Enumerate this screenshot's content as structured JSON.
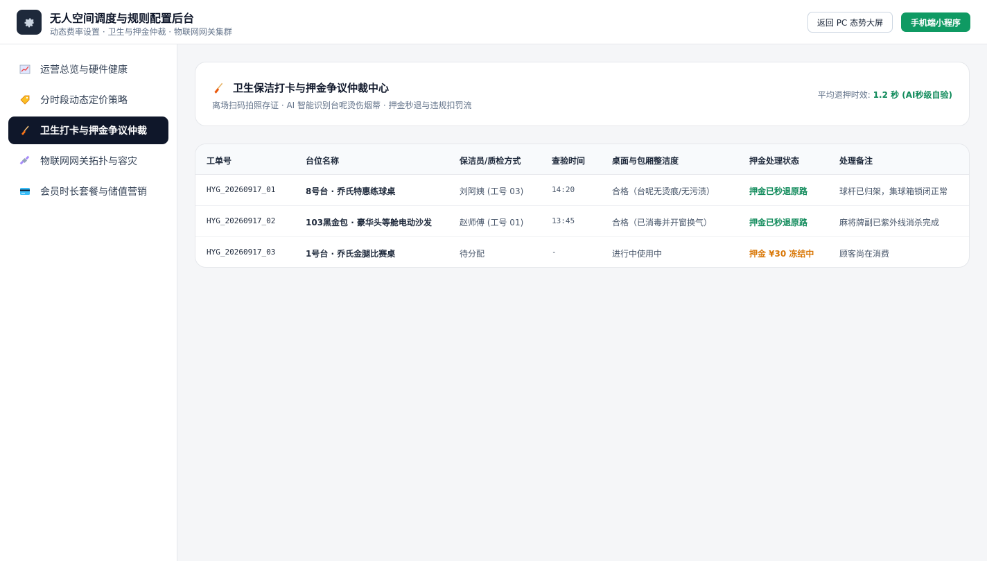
{
  "header": {
    "title": "无人空间调度与规则配置后台",
    "subtitle": "动态费率设置 · 卫生与押金仲裁 · 物联网网关集群",
    "back_button": "返回 PC 态势大屏",
    "mini_program_button": "手机端小程序",
    "logo_icon": "gear-icon"
  },
  "sidebar": {
    "items": [
      {
        "label": "运营总览与硬件健康",
        "icon": "chart-line-icon",
        "active": false
      },
      {
        "label": "分时段动态定价策略",
        "icon": "price-tag-icon",
        "active": false
      },
      {
        "label": "卫生打卡与押金争议仲裁",
        "icon": "broom-icon",
        "active": true
      },
      {
        "label": "物联网网关拓扑与容灾",
        "icon": "satellite-icon",
        "active": false
      },
      {
        "label": "会员时长套餐与储值营销",
        "icon": "credit-card-icon",
        "active": false
      }
    ]
  },
  "hero": {
    "title": "卫生保洁打卡与押金争议仲裁中心",
    "subtitle": "离场扫码拍照存证 · AI 智能识别台呢烫伤烟蒂 · 押金秒退与违规扣罚流",
    "stat_label": "平均退押时效: ",
    "stat_value": "1.2 秒 (AI秒级自验)"
  },
  "table": {
    "headers": [
      "工单号",
      "台位名称",
      "保洁员/质检方式",
      "查验时间",
      "桌面与包厢整洁度",
      "押金处理状态",
      "处理备注"
    ],
    "rows": [
      {
        "id": "HYG_20260917_01",
        "table": "8号台 · 乔氏特惠练球桌",
        "cleaner": "刘阿姨 (工号 03)",
        "time": "14:20",
        "cleanliness": "合格（台呢无烫痕/无污渍）",
        "status": "押金已秒退原路",
        "status_type": "green",
        "note": "球杆已归架，集球箱锁闭正常"
      },
      {
        "id": "HYG_20260917_02",
        "table": "103黑金包 · 豪华头等舱电动沙发",
        "cleaner": "赵师傅 (工号 01)",
        "time": "13:45",
        "cleanliness": "合格（已消毒并开窗换气）",
        "status": "押金已秒退原路",
        "status_type": "green",
        "note": "麻将牌副已紫外线消杀完成"
      },
      {
        "id": "HYG_20260917_03",
        "table": "1号台 · 乔氏金腿比赛桌",
        "cleaner": "待分配",
        "time": "-",
        "cleanliness": "进行中使用中",
        "status": "押金 ¥30 冻结中",
        "status_type": "orange",
        "note": "顾客尚在消费"
      }
    ]
  },
  "colors": {
    "accent_dark": "#0f172a",
    "accent_green": "#0f9a63",
    "status_green": "#0f8a5a",
    "status_orange": "#d97706"
  }
}
